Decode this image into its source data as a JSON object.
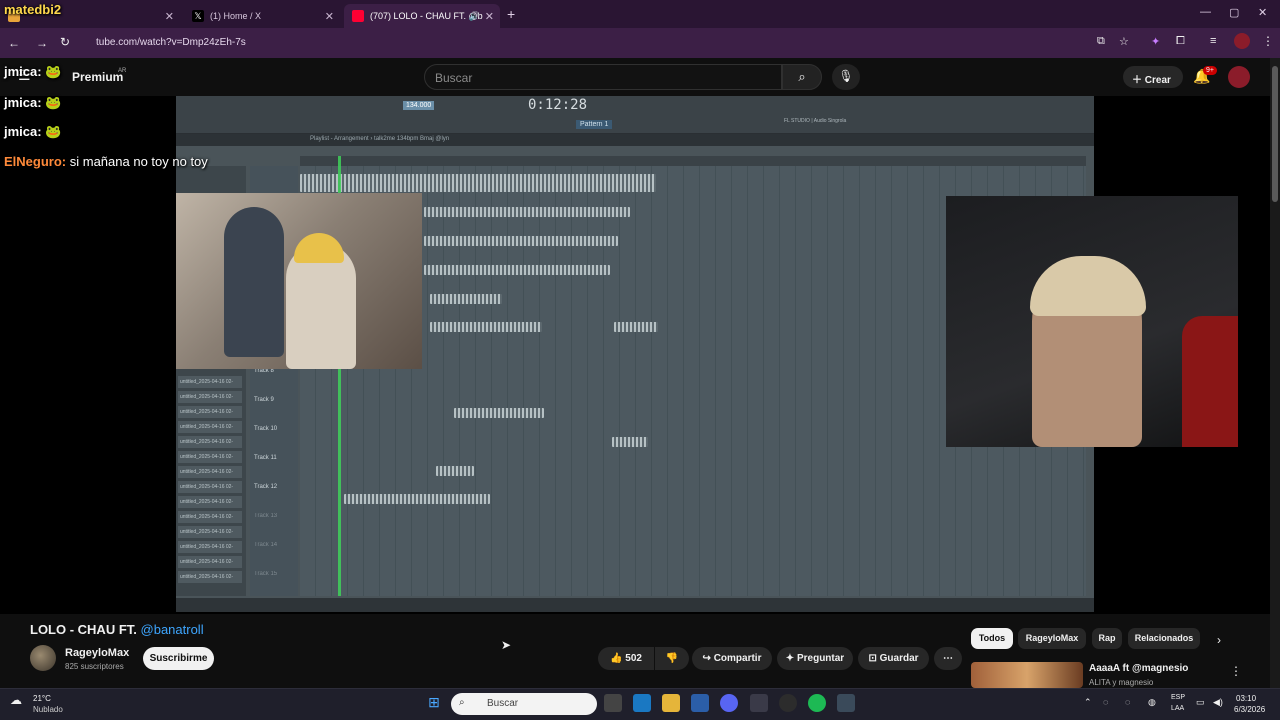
{
  "browser": {
    "tabs": [
      {
        "label": "",
        "favicon": "profile"
      },
      {
        "label": "(1) Home / X",
        "favicon": "x-logo"
      },
      {
        "label": "(707) LOLO - CHAU FT. @b",
        "favicon": "youtube"
      }
    ],
    "new_tab": "+",
    "url": "tube.com/watch?v=Dmp24zEh-7s",
    "window_controls": [
      "—",
      "▢",
      "✕"
    ]
  },
  "youtube": {
    "logo_text": "Premium",
    "logo_region": "AR",
    "search_placeholder": "Buscar",
    "create_label": "Crear",
    "notif_badge": "9+"
  },
  "chat_overlay": [
    {
      "user": "jmica:",
      "text": ""
    },
    {
      "user": "jmica:",
      "text": ""
    },
    {
      "user": "jmica:",
      "text": ""
    },
    {
      "user": "ElNeguro:",
      "text": "si mañana no toy no toy"
    }
  ],
  "overlay_brand": "matedbi2",
  "fl_studio": {
    "timer": "0:12:28",
    "tempo": "134.000",
    "pattern": "Pattern 1",
    "playlist_title": "Playlist - Arrangement › talk2me 134bpm Bmaj @lyn",
    "title_text": "FL STUDIO | Audio Singrola",
    "track_labels": [
      "Track 8",
      "Track 9",
      "Track 10",
      "Track 11",
      "Track 12",
      "Track 13",
      "Track 14",
      "Track 15"
    ],
    "clip_names": [
      "untitled_2025-04-16 02-",
      "untitled_2025-04-16 02-",
      "untitled_2025-04-16 02-",
      "untitled_2025-04-16 02-",
      "untitled_2025-04-16 02-",
      "untitled_2025-04-16 02-",
      "untitled_2025-04-16 02-",
      "untitled_2025-04-16 02-",
      "untitled_2025-04-16 02-",
      "untitled_2025-04-16 02-",
      "untitled_2025-04-16 02-",
      "untitled_2025-04-16 02-",
      "untitled_2025-04-16 02-",
      "untitled_2025-04-16 02-"
    ]
  },
  "video": {
    "title": "LOLO - CHAU FT.",
    "title_mention": "@banatroll",
    "channel": "RageyloMax",
    "subscribers": "825 suscriptores",
    "subscribe_label": "Suscribirme",
    "likes": "502",
    "share_label": "Compartir",
    "ask_label": "Preguntar",
    "save_label": "Guardar",
    "more": "⋯"
  },
  "chips": [
    "Todos",
    "RageyloMax",
    "Rap",
    "Relacionados"
  ],
  "recommendation": {
    "title": "AaaaA ft @magnesio",
    "channel": "ALITA y magnesio"
  },
  "taskbar": {
    "weather_temp": "21°C",
    "weather_desc": "Nublado",
    "search_placeholder": "Buscar",
    "lang": "ESP",
    "lang_sub": "LAA",
    "time": "03:10",
    "date": "6/3/2026"
  },
  "colors": {
    "browser_tabstrip": "#2a1533",
    "browser_urlbar": "#3c1f46",
    "yt_bg": "#0f0f0f",
    "mention": "#3ea6ff",
    "playhead": "#3fd15a"
  }
}
